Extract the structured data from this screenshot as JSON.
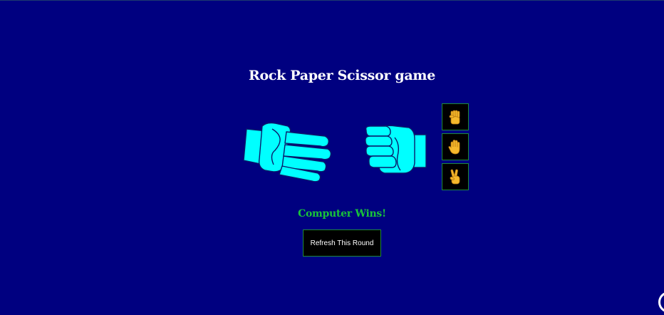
{
  "game": {
    "title": "Rock Paper Scissor game",
    "player_hand": "paper",
    "computer_hand": "rock",
    "result_text": "Computer Wins!",
    "refresh_label": "Refresh This Round"
  },
  "choices": [
    {
      "name": "rock",
      "icon": "raised-fist-icon"
    },
    {
      "name": "paper",
      "icon": "raised-hand-icon"
    },
    {
      "name": "scissors",
      "icon": "victory-hand-icon"
    }
  ],
  "colors": {
    "background": "#000080",
    "hand_fill": "#00ffff",
    "result": "#18c43a",
    "button_border": "#1f8a3a",
    "emoji": "#f6b92c"
  }
}
